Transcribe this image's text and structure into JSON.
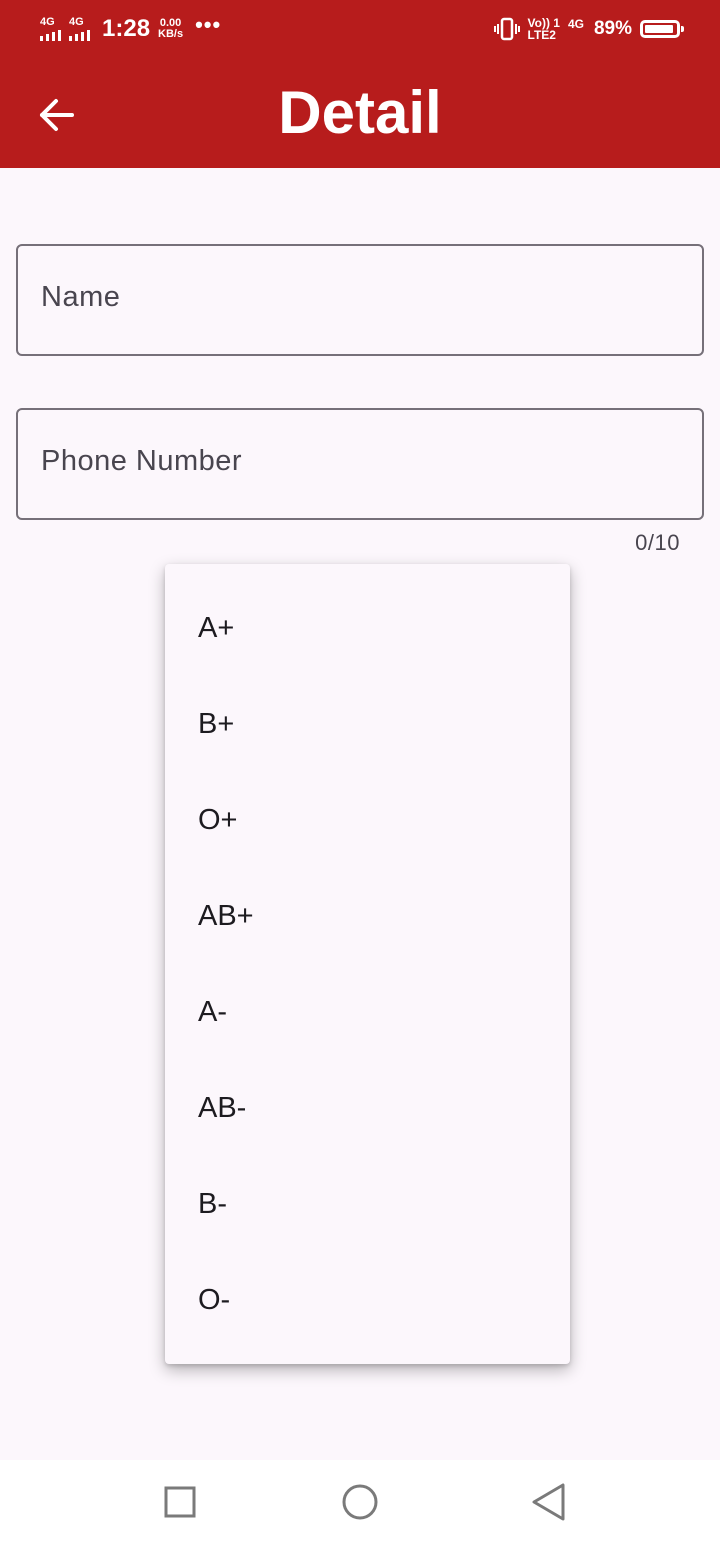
{
  "status_bar": {
    "network_1": "4G",
    "network_2": "4G",
    "time": "1:28",
    "speed_value": "0.00",
    "speed_unit": "KB/s",
    "more": "•••",
    "volte_top": "Vo)) 1",
    "volte_bottom": "LTE2",
    "network_3": "4G",
    "battery_percent": "89%",
    "battery_level": 0.89
  },
  "app_bar": {
    "title": "Detail",
    "back_icon": "arrow-back-icon",
    "background": "#b71c1c"
  },
  "form": {
    "name_label": "Name",
    "phone_label": "Phone Number",
    "phone_counter": "0/10"
  },
  "dropdown": {
    "options": [
      "A+",
      "B+",
      "O+",
      "AB+",
      "A-",
      "AB-",
      "B-",
      "O-"
    ]
  },
  "nav_bar": {
    "icons": [
      "recent-apps-icon",
      "home-icon",
      "back-icon"
    ]
  }
}
